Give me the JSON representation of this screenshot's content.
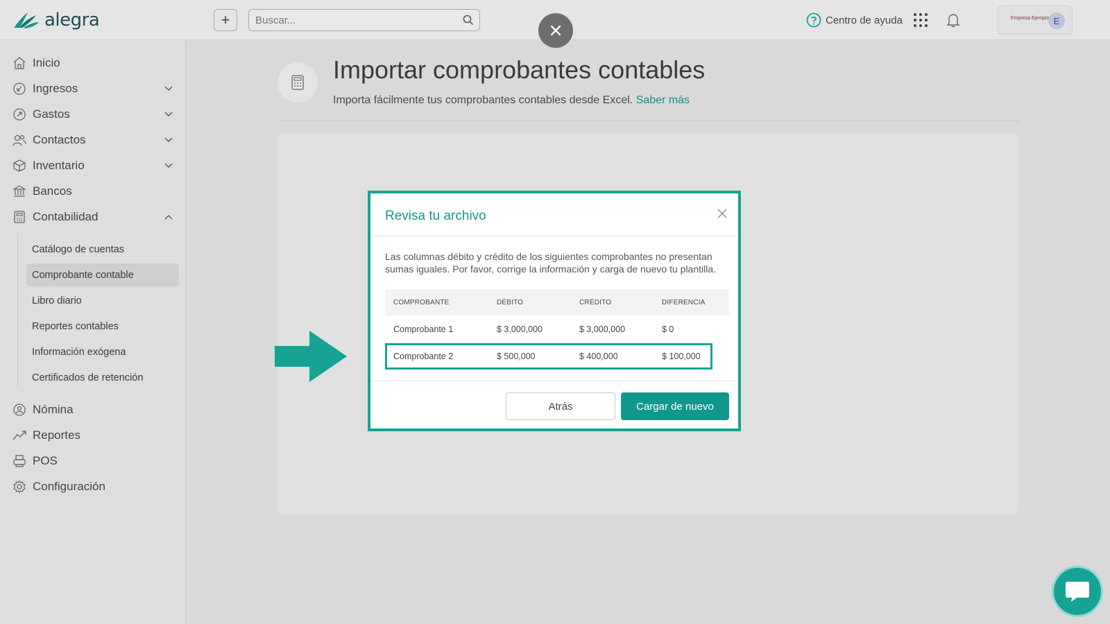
{
  "app": {
    "brand": "alegra"
  },
  "header": {
    "search_placeholder": "Buscar...",
    "help_label": "Centro de ayuda",
    "company_brand": "Empresa Ejemplo",
    "avatar_initial": "E"
  },
  "sidebar": {
    "items": [
      {
        "label": "Inicio",
        "icon": "home-icon"
      },
      {
        "label": "Ingresos",
        "icon": "income-icon"
      },
      {
        "label": "Gastos",
        "icon": "expenses-icon"
      },
      {
        "label": "Contactos",
        "icon": "contacts-icon"
      },
      {
        "label": "Inventario",
        "icon": "inventory-icon"
      },
      {
        "label": "Bancos",
        "icon": "bank-icon"
      },
      {
        "label": "Contabilidad",
        "icon": "accounting-icon"
      },
      {
        "label": "Nómina",
        "icon": "payroll-icon"
      },
      {
        "label": "Reportes",
        "icon": "reports-icon"
      },
      {
        "label": "POS",
        "icon": "pos-icon"
      },
      {
        "label": "Configuración",
        "icon": "settings-icon"
      }
    ],
    "sub_items": [
      {
        "label": "Catálogo de cuentas"
      },
      {
        "label": "Comprobante contable"
      },
      {
        "label": "Libro diario"
      },
      {
        "label": "Reportes contables"
      },
      {
        "label": "Información exógena"
      },
      {
        "label": "Certificados de retención"
      }
    ]
  },
  "main": {
    "title": "Importar comprobantes contables",
    "subtitle": "Importa fácilmente tus comprobantes contables desde Excel.",
    "learn_more": "Saber más"
  },
  "modal": {
    "title": "Revisa tu archivo",
    "message": "Las columnas débito y crédito de los siguientes comprobantes no presentan sumas iguales. Por favor, corrige la información y carga de nuevo tu plantilla.",
    "columns": [
      "COMPROBANTE",
      "DÉBITO",
      "CRÉDITO",
      "DIFERENCIA"
    ],
    "rows": [
      [
        "Comprobante 1",
        "$ 3,000,000",
        "$ 3,000,000",
        "$ 0"
      ],
      [
        "Comprobante 2",
        "$ 500,000",
        "$ 400,000",
        "$ 100,000"
      ]
    ],
    "back_label": "Atrás",
    "reload_label": "Cargar de nuevo"
  },
  "colors": {
    "accent": "#11988c",
    "highlight": "#16a394"
  }
}
